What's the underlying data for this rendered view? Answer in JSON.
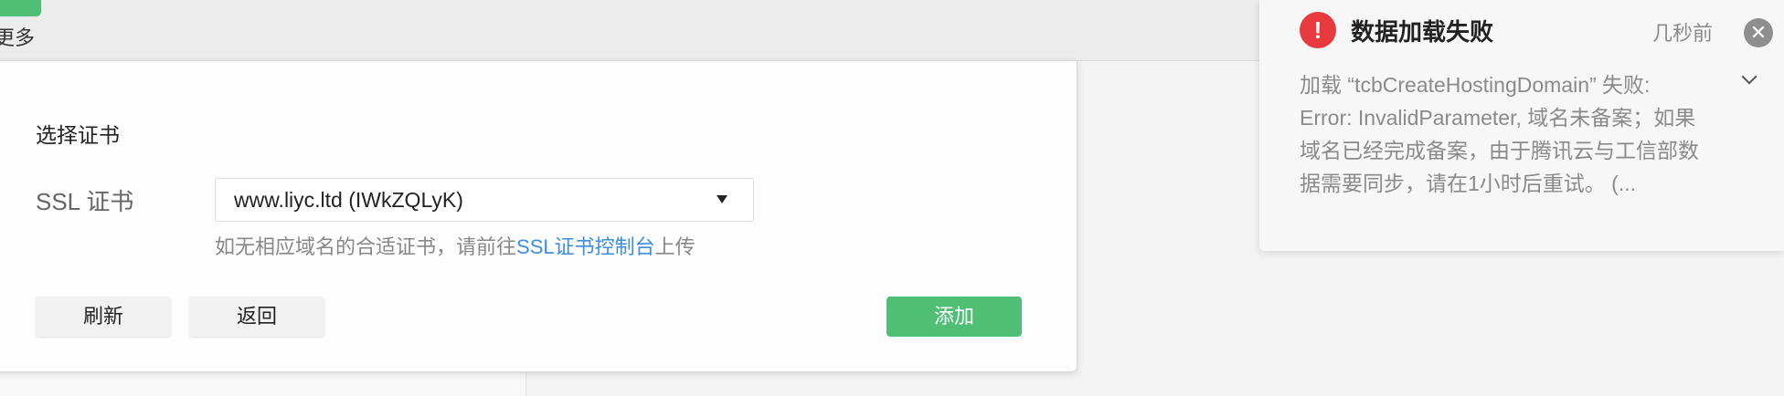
{
  "top": {
    "more_label": "更多"
  },
  "modal": {
    "title": "选择证书",
    "ssl_label": "SSL 证书",
    "select_value": "www.liyc.ltd (IWkZQLyK)",
    "hint_prefix": "如无相应域名的合适证书，请前往",
    "hint_link": "SSL证书控制台",
    "hint_suffix": "上传",
    "refresh_label": "刷新",
    "back_label": "返回",
    "add_label": "添加"
  },
  "toast": {
    "icon": "error-icon",
    "icon_glyph": "!",
    "title": "数据加载失败",
    "time": "几秒前",
    "close_glyph": "✕",
    "message": "加载 “tcbCreateHostingDomain” 失败: Error: InvalidParameter, 域名未备案；如果域名已经完成备案，由于腾讯云与工信部数据需要同步，请在1小时后重试。 (..."
  },
  "colors": {
    "accent_green": "#4fbf76",
    "error_red": "#e8393f",
    "link_blue": "#3d8ee0"
  }
}
